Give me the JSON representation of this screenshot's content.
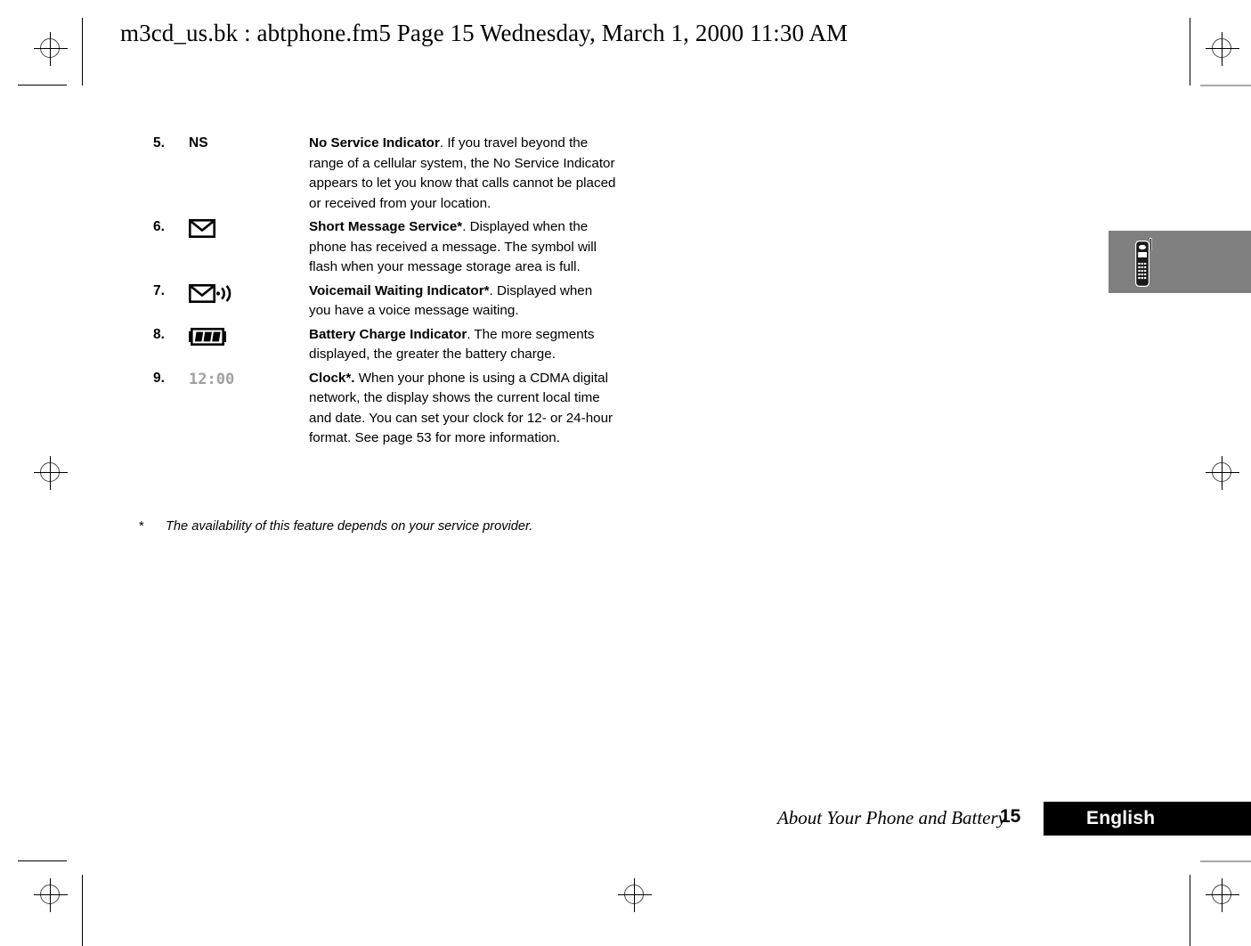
{
  "header": {
    "text": "m3cd_us.bk : abtphone.fm5  Page 15  Wednesday, March 1, 2000  11:30 AM"
  },
  "side_tab": {
    "icon": "cellular-phone-icon",
    "background_color": "#808080"
  },
  "list": {
    "items": [
      {
        "number": "5.",
        "symbol_kind": "text",
        "symbol_text": "NS",
        "title": "No Service Indicator",
        "body": ". If you travel beyond the range of a cellular system, the No Service Indicator appears to let you know that calls cannot be placed or received from your location."
      },
      {
        "number": "6.",
        "symbol_kind": "envelope",
        "symbol_text": "",
        "title": "Short Message Service*",
        "body": ". Displayed when the phone has received a message. The symbol will flash when your message storage area is full."
      },
      {
        "number": "7.",
        "symbol_kind": "envelope-sound",
        "symbol_text": "",
        "title": "Voicemail Waiting Indicator*",
        "body": ". Displayed when you have a voice message waiting."
      },
      {
        "number": "8.",
        "symbol_kind": "battery",
        "symbol_text": "",
        "title": "Battery Charge Indicator",
        "body": ". The more segments displayed, the greater the battery charge."
      },
      {
        "number": "9.",
        "symbol_kind": "lcd-clock",
        "symbol_text": "12:00",
        "title": "Clock*.",
        "body": " When your phone is using a CDMA digital network, the display shows the current local time and date. You can set your clock for 12- or 24-hour format. See page 53 for more information."
      }
    ]
  },
  "footnote": {
    "marker": "*",
    "text": "The availability of this feature depends on your service provider."
  },
  "footer": {
    "section_title": "About Your Phone and Battery",
    "page_number": "15",
    "language": "English",
    "language_bar_color": "#000000"
  }
}
